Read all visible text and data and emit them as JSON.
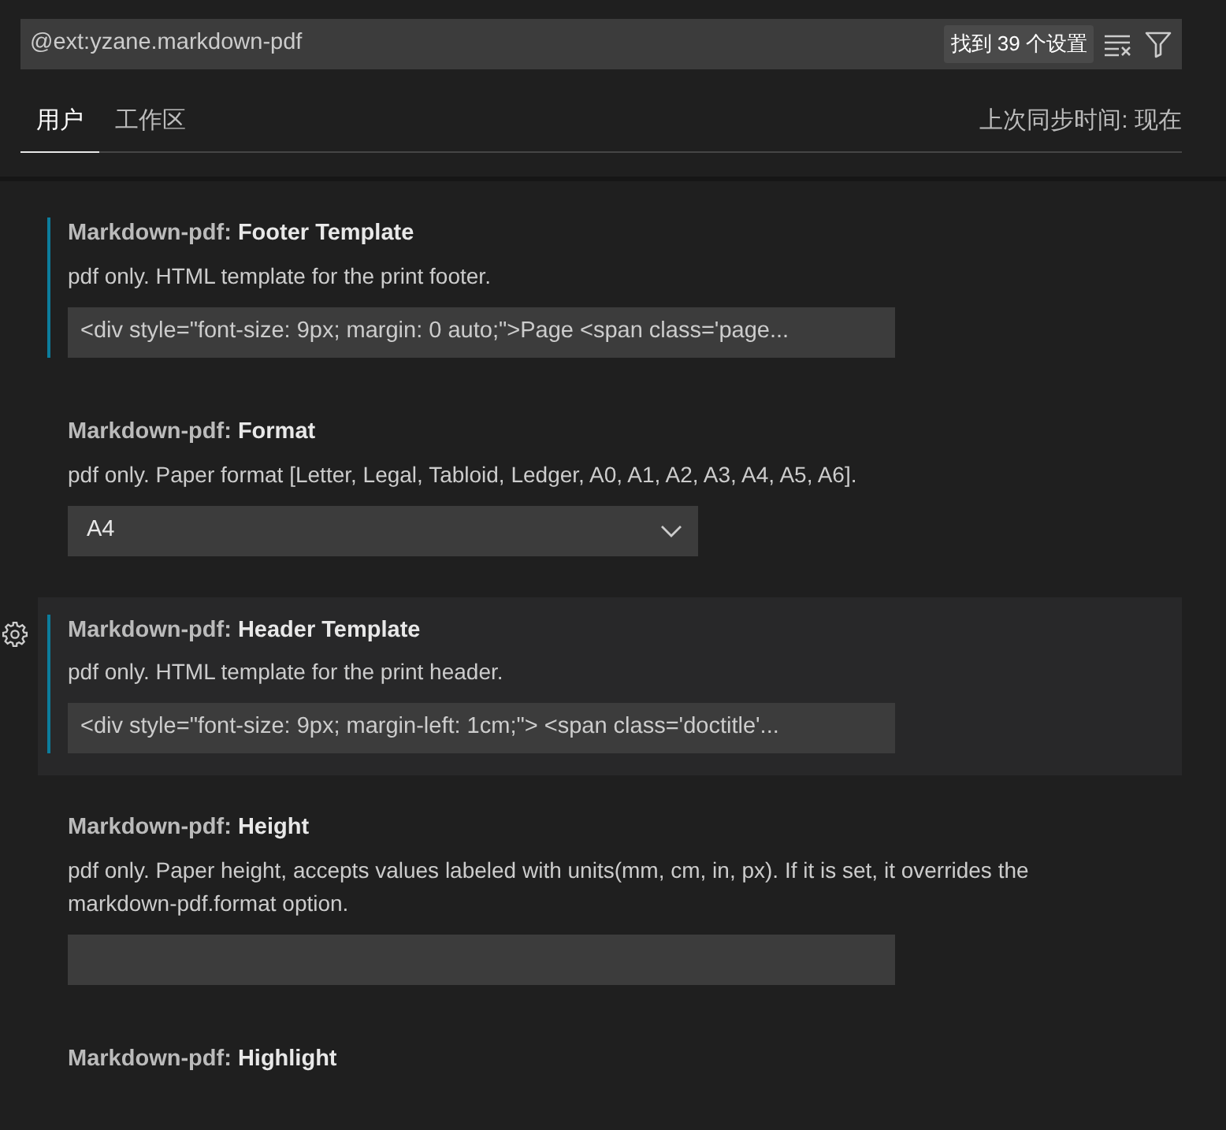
{
  "search": {
    "value": "@ext:yzane.markdown-pdf",
    "result_count": "找到 39 个设置"
  },
  "tabs": [
    {
      "label": "用户",
      "selected": true
    },
    {
      "label": "工作区",
      "selected": false
    }
  ],
  "sync_status": "上次同步时间: 现在",
  "settings": [
    {
      "category": "Markdown-pdf: ",
      "name": "Footer Template",
      "description": "pdf only. HTML template for the print footer.",
      "kind": "text",
      "value": "<div style=\"font-size: 9px; margin: 0 auto;\">Page  <span class='page...",
      "modified": true,
      "focused": false
    },
    {
      "category": "Markdown-pdf: ",
      "name": "Format",
      "description": "pdf only. Paper format [Letter, Legal, Tabloid, Ledger, A0, A1, A2, A3, A4, A5, A6].",
      "kind": "select",
      "value": "A4",
      "modified": false,
      "focused": false
    },
    {
      "category": "Markdown-pdf: ",
      "name": "Header Template",
      "description": "pdf only. HTML template for the print header.",
      "kind": "text",
      "value": "<div style=\"font-size: 9px; margin-left: 1cm;\"> <span class='doctitle'...",
      "modified": true,
      "focused": true
    },
    {
      "category": "Markdown-pdf: ",
      "name": "Height",
      "description": "pdf only. Paper height, accepts values labeled with units(mm, cm, in, px). If it is set, it overrides the markdown-pdf.format option.",
      "kind": "text",
      "modified": false,
      "focused": false
    },
    {
      "category": "Markdown-pdf: ",
      "name": "Highlight",
      "kind": "title",
      "modified": false,
      "focused": false
    }
  ]
}
